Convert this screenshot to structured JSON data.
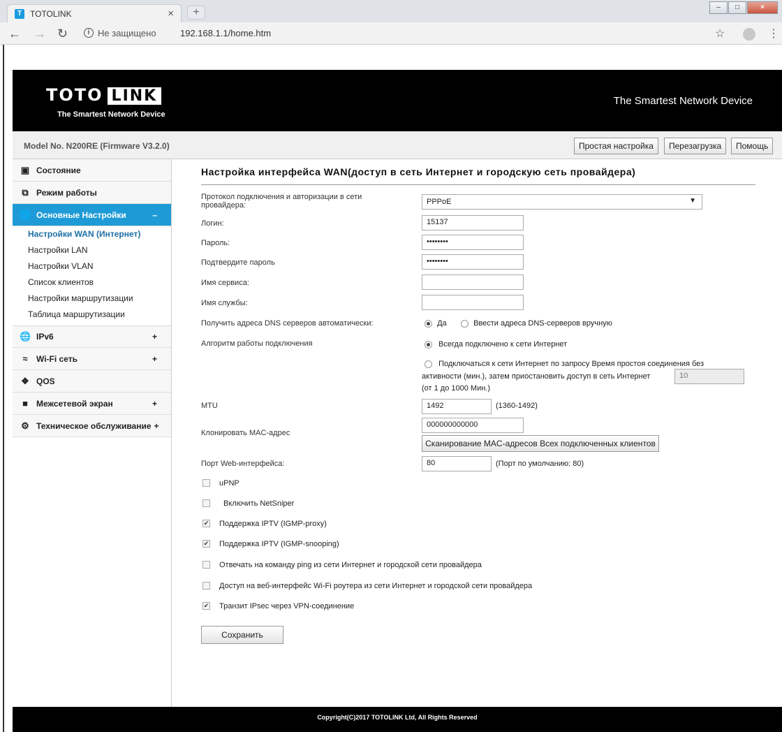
{
  "browser": {
    "tab_title": "TOTOLINK",
    "tab_favicon": "T",
    "close": "×",
    "new_tab": "+",
    "security_text": "Не защищено",
    "url": "192.168.1.1/home.htm",
    "icons": [
      "back-icon",
      "forward-icon",
      "reload-icon",
      "info-icon",
      "star-icon",
      "avatar-icon",
      "menu-icon"
    ]
  },
  "header": {
    "logo_left": "TOTO",
    "logo_right": "LINK",
    "logo_tagline": "The Smartest Network Device",
    "slogan": "The Smartest Network Device"
  },
  "modelbar": {
    "model": "Model No. N200RE (Firmware V3.2.0)",
    "buttons": [
      "Простая настройка",
      "Перезагрузка",
      "Помощь"
    ]
  },
  "sidebar": {
    "sections": [
      {
        "label": "Состояние",
        "icon": "monitor-icon"
      },
      {
        "label": "Режим работы",
        "icon": "mode-icon"
      },
      {
        "label": "Основные Настройки",
        "icon": "globe-icon",
        "toggle": "–",
        "active": true
      },
      {
        "label": "IPv6",
        "icon": "globe-icon",
        "toggle": "+"
      },
      {
        "label": "Wi-Fi сеть",
        "icon": "wifi-icon",
        "toggle": "+"
      },
      {
        "label": "QOS",
        "icon": "qos-icon"
      },
      {
        "label": "Межсетевой экран",
        "icon": "lock-icon",
        "toggle": "+"
      },
      {
        "label": "Техническое обслуживание",
        "icon": "gear-icon",
        "toggle": "+"
      }
    ],
    "subitems": [
      "Настройки WAN (Интернет)",
      "Настройки LAN",
      "Настройки VLAN",
      "Список клиентов",
      "Настройки маршрутизации",
      "Таблица маршрутизации"
    ]
  },
  "form": {
    "title": "Настройка интерфейса WAN(доступ в сеть Интернет и городскую сеть провайдера)",
    "protocol_label": "Протокол подключения и авторизации в сети провайдера:",
    "protocol_value": "PPPoE",
    "login_label": "Логин:",
    "login_value": "15137",
    "password_label": "Пароль:",
    "password_value": "••••••••",
    "confirm_label": "Подтвердите пароль",
    "confirm_value": "••••••••",
    "service_name_label": "Имя сервиса:",
    "service_label": "Имя службы:",
    "dns_label": "Получить адреса DNS серверов автоматически:",
    "dns_yes": "Да",
    "dns_manual": "Ввести адреса DNS-серверов вручную",
    "algo_label": "Алгоритм работы подключения",
    "algo_always": "Всегда подключено к сети Интернет",
    "algo_demand_1": "Подключаться к сети Интернет по запросу  Время простоя соединения без",
    "algo_demand_2": "активности (мин.), затем приостановить доступ в сеть Интернет",
    "idle_value": "10",
    "idle_range": "(от 1 до 1000 Мин.)",
    "mtu_label": "MTU",
    "mtu_value": "1492",
    "mtu_range": "(1360-1492)",
    "mac_label": "Клонировать MAC-адрес",
    "mac_value": "000000000000",
    "mac_scan_button": "Сканирование MAC-адресов Всех подключенных клиентов",
    "port_label": "Порт Web-интерфейса:",
    "port_value": "80",
    "port_default": "(Порт по умолчанию: 80)",
    "checkboxes": [
      {
        "label": "uPNP",
        "checked": false
      },
      {
        "label": "Включить NetSniper",
        "checked": false
      },
      {
        "label": "Поддержка IPTV (IGMP-proxy)",
        "checked": true
      },
      {
        "label": "Поддержка IPTV (IGMP-snooping)",
        "checked": true
      },
      {
        "label": "Отвечать на команду ping из сети Интернет и городской сети провайдера",
        "checked": false
      },
      {
        "label": "Доступ на веб-интерфейс Wi-Fi роутера из сети Интернет и городской сети провайдера",
        "checked": false
      },
      {
        "label": "Транзит IPsec через VPN-соединение",
        "checked": true
      }
    ],
    "save_button": "Сохранить"
  },
  "footer": {
    "copyright": "Copyright(C)2017 TOTOLINK Ltd, All Rights Reserved"
  }
}
